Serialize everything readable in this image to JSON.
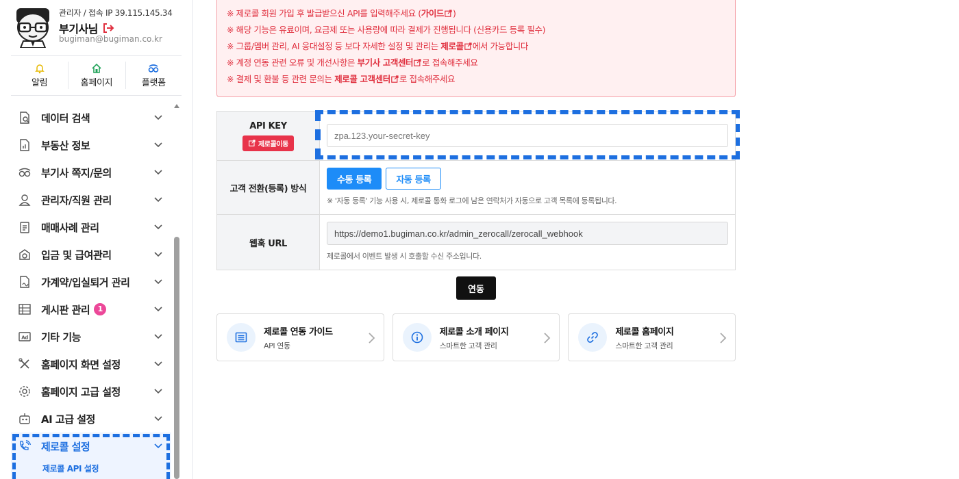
{
  "profile": {
    "meta": "관리자 / 접속 IP 39.115.145.34",
    "name": "부기사님",
    "email": "bugiman@bugiman.co.kr"
  },
  "quick_links": [
    {
      "label": "알림",
      "icon": "bell-icon"
    },
    {
      "label": "홈페이지",
      "icon": "home-icon"
    },
    {
      "label": "플랫폼",
      "icon": "platform-icon"
    }
  ],
  "menu": [
    {
      "label": "데이터 검색",
      "icon": "data-search-icon"
    },
    {
      "label": "부동산 정보",
      "icon": "document-chart-icon"
    },
    {
      "label": "부기사 쪽지/문의",
      "icon": "glasses-icon"
    },
    {
      "label": "관리자/직원 관리",
      "icon": "user-icon"
    },
    {
      "label": "매매사례 관리",
      "icon": "clipboard-icon"
    },
    {
      "label": "입금 및 급여관리",
      "icon": "money-icon"
    },
    {
      "label": "가계약/입실퇴거 관리",
      "icon": "contract-icon"
    },
    {
      "label": "게시판 관리",
      "icon": "table-icon",
      "badge": "1"
    },
    {
      "label": "기타 기능",
      "icon": "ad-icon"
    },
    {
      "label": "홈페이지 화면 설정",
      "icon": "tools-icon"
    },
    {
      "label": "홈페이지 고급 설정",
      "icon": "gear-icon"
    },
    {
      "label": "AI 고급 설정",
      "icon": "robot-icon"
    },
    {
      "label": "제로콜 설정",
      "icon": "phone-wave-icon",
      "active": true
    }
  ],
  "submenu": {
    "label": "제로콜 API 설정"
  },
  "notice": {
    "lines": [
      {
        "pre": "※ 제로콜 회원 가입 후 발급받으신 API를 입력해주세요 (",
        "bold": "가이드",
        "post": ")"
      },
      {
        "pre": "※ 해당 기능은 유료이며, 요금제 또는 사용량에 따라 결제가 진행됩니다 (신용카드 등록 필수)",
        "bold": "",
        "post": ""
      },
      {
        "pre": "※ 그룹/멤버 관리, AI 응대설정 등 보다 자세한 설정 및 관리는 ",
        "bold": "제로콜",
        "post": "에서 가능합니다"
      },
      {
        "pre": "※ 계정 연동 관련 오류 및 개선사항은 ",
        "bold": "부기사 고객센터",
        "post": "로 접속해주세요"
      },
      {
        "pre": "※ 결제 및 환불 등 관련 문의는 ",
        "bold": "제로콜 고객센터",
        "post": "로 접속해주세요"
      }
    ]
  },
  "form": {
    "api_key": {
      "label": "API KEY",
      "go_button": "제로콜이동",
      "placeholder": "zpa.123.your-secret-key"
    },
    "conversion": {
      "label": "고객 전환(등록) 방식",
      "manual": "수동 등록",
      "auto": "자동 등록",
      "help": "※ '자동 등록' 기능 사용 시, 제로콜 통화 로그에 남은 연락처가 자동으로 고객 목록에 등록됩니다."
    },
    "webhook": {
      "label": "웹훅 URL",
      "value": "https://demo1.bugiman.co.kr/admin_zerocall/zerocall_webhook",
      "help": "제로콜에서 이벤트 발생 시 호출할 수신 주소입니다."
    }
  },
  "connect_button": "연동",
  "cards": [
    {
      "title": "제로콜 연동 가이드",
      "sub": "API 연동",
      "icon": "list-icon"
    },
    {
      "title": "제로콜 소개 페이지",
      "sub": "스마트한 고객 관리",
      "icon": "info-icon"
    },
    {
      "title": "제로콜 홈페이지",
      "sub": "스마트한 고객 관리",
      "icon": "link-icon"
    }
  ],
  "colors": {
    "accent": "#1d6fe0",
    "notice_text": "#e0303f",
    "badge": "#ec4899"
  }
}
